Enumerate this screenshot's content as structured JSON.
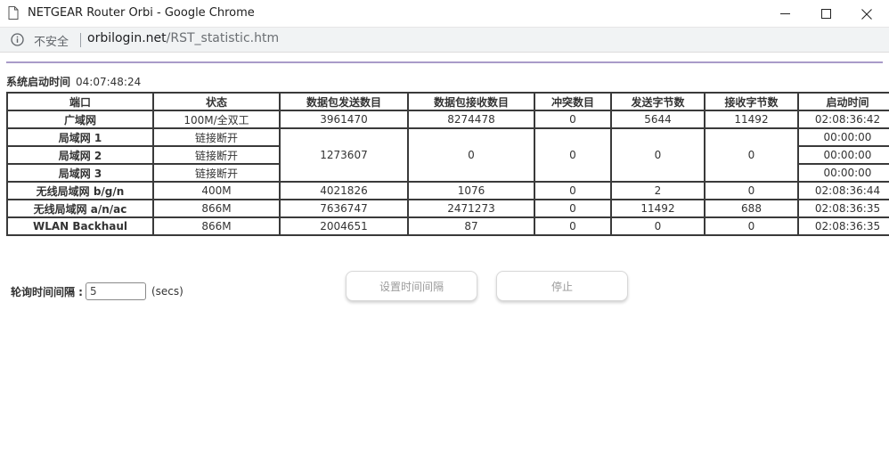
{
  "window": {
    "title": "NETGEAR Router Orbi - Google Chrome"
  },
  "address_bar": {
    "security_label": "不安全",
    "url_host": "orbilogin.net",
    "url_path": "/RST_statistic.htm"
  },
  "uptime": {
    "label": "系统启动时间",
    "value": "04:07:48:24"
  },
  "table": {
    "headers": [
      "端口",
      "状态",
      "数据包发送数目",
      "数据包接收数目",
      "冲突数目",
      "发送字节数",
      "接收字节数",
      "启动时间"
    ],
    "wan": {
      "port": "广域网",
      "status": "100M/全双工",
      "tx_pkts": "3961470",
      "rx_pkts": "8274478",
      "collisions": "0",
      "tx_bytes": "5644",
      "rx_bytes": "11492",
      "uptime": "02:08:36:42"
    },
    "lan": {
      "ports": [
        {
          "port": "局域网 1",
          "status": "链接断开",
          "uptime": "00:00:00"
        },
        {
          "port": "局域网 2",
          "status": "链接断开",
          "uptime": "00:00:00"
        },
        {
          "port": "局域网 3",
          "status": "链接断开",
          "uptime": "00:00:00"
        }
      ],
      "tx_pkts": "1273607",
      "rx_pkts": "0",
      "collisions": "0",
      "tx_bytes": "0",
      "rx_bytes": "0"
    },
    "wlan_bgn": {
      "port": "无线局域网 b/g/n",
      "status": "400M",
      "tx_pkts": "4021826",
      "rx_pkts": "1076",
      "collisions": "0",
      "tx_bytes": "2",
      "rx_bytes": "0",
      "uptime": "02:08:36:44"
    },
    "wlan_anac": {
      "port": "无线局域网 a/n/ac",
      "status": "866M",
      "tx_pkts": "7636747",
      "rx_pkts": "2471273",
      "collisions": "0",
      "tx_bytes": "11492",
      "rx_bytes": "688",
      "uptime": "02:08:36:35"
    },
    "backhaul": {
      "port": "WLAN Backhaul",
      "status": "866M",
      "tx_pkts": "2004651",
      "rx_pkts": "87",
      "collisions": "0",
      "tx_bytes": "0",
      "rx_bytes": "0",
      "uptime": "02:08:36:35"
    }
  },
  "poll": {
    "label": "轮询时间间隔 :",
    "value": "5",
    "unit": "(secs)"
  },
  "buttons": {
    "set_interval": "设置时间间隔",
    "stop": "停止"
  },
  "colors": {
    "accent_rule": "#a99bc9",
    "table_border": "#3a3a3a"
  }
}
